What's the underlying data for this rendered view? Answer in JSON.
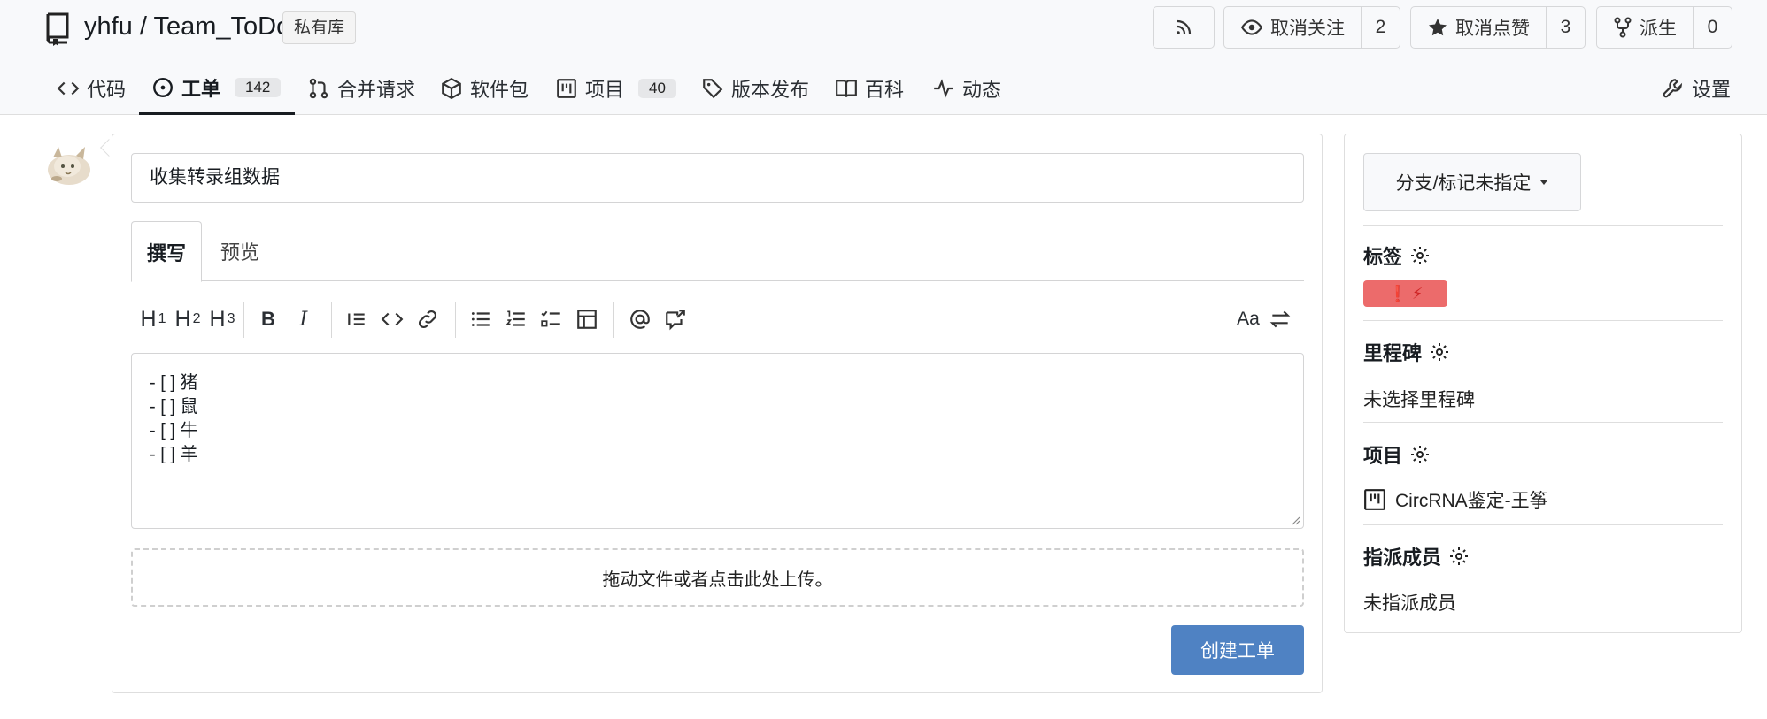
{
  "repo": {
    "owner": "yhfu",
    "separator": "/",
    "name": "Team_ToDo",
    "badge": "私有库"
  },
  "header_actions": {
    "rss_icon": "rss-icon",
    "watch": {
      "label": "取消关注",
      "count": "2",
      "icon": "eye-icon"
    },
    "star": {
      "label": "取消点赞",
      "count": "3",
      "icon": "star-icon"
    },
    "fork": {
      "label": "派生",
      "count": "0",
      "icon": "fork-icon"
    }
  },
  "nav": {
    "code": "代码",
    "issues": "工单",
    "issues_count": "142",
    "pulls": "合并请求",
    "packages": "软件包",
    "projects": "项目",
    "projects_count": "40",
    "releases": "版本发布",
    "wiki": "百科",
    "activity": "动态",
    "settings": "设置"
  },
  "form": {
    "title_value": "收集转录组数据",
    "tab_write": "撰写",
    "tab_preview": "预览",
    "toolbar": {
      "h1": "H",
      "h1_sub": "1",
      "h2": "H",
      "h2_sub": "2",
      "h3": "H",
      "h3_sub": "3",
      "bold": "B",
      "italic": "I",
      "aa": "Aa"
    },
    "body_lines": [
      "- [ ] 猪",
      "- [ ] 鼠",
      "- [ ] 牛",
      "- [ ] 羊"
    ],
    "dropzone": "拖动文件或者点击此处上传。",
    "submit": "创建工单"
  },
  "sidebar": {
    "branch": "分支/标记未指定",
    "labels_title": "标签",
    "label_chip": "❗ ⚡",
    "milestone_title": "里程碑",
    "milestone_value": "未选择里程碑",
    "projects_title": "项目",
    "project_value": "CircRNA鉴定-王筝",
    "assignees_title": "指派成员",
    "assignees_value": "未指派成员"
  },
  "colors": {
    "accent": "#4f82c3",
    "label_bg": "#ec6b6b",
    "border": "#dedede",
    "header_bg": "#f8f9fb"
  }
}
